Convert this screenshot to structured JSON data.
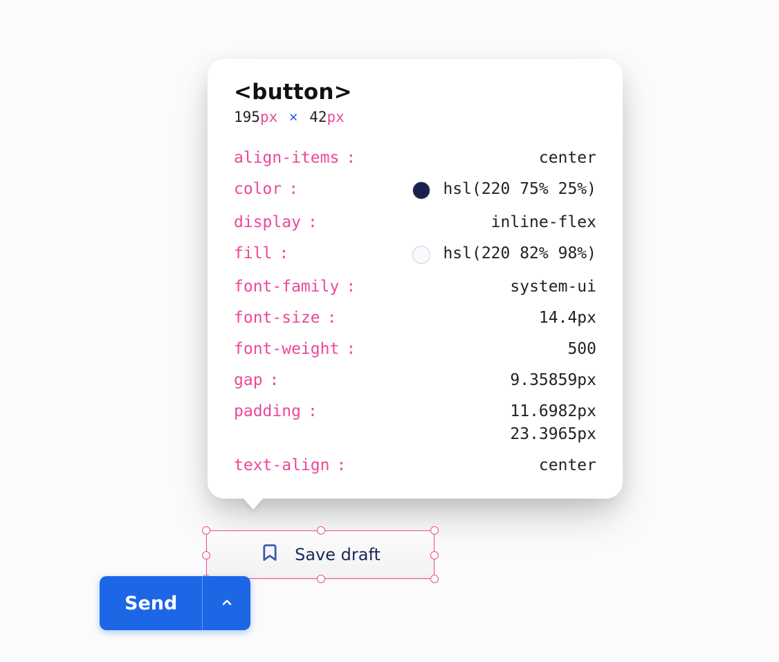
{
  "inspector": {
    "element_tag": "<button>",
    "dimensions": {
      "w": "195",
      "h": "42",
      "unit": "px"
    },
    "properties": [
      {
        "name": "align-items",
        "value": "center"
      },
      {
        "name": "color",
        "value": "hsl(220 75% 25%)",
        "swatch": "#17234d"
      },
      {
        "name": "display",
        "value": "inline-flex"
      },
      {
        "name": "fill",
        "value": "hsl(220 82% 98%)",
        "swatch": "#f7faff"
      },
      {
        "name": "font-family",
        "value": "system-ui"
      },
      {
        "name": "font-size",
        "value": "14.4px"
      },
      {
        "name": "font-weight",
        "value": "500"
      },
      {
        "name": "gap",
        "value": "9.35859px"
      },
      {
        "name": "padding",
        "value": "11.6982px",
        "value2": "23.3965px"
      },
      {
        "name": "text-align",
        "value": "center"
      }
    ]
  },
  "selected_button": {
    "label": "Save draft",
    "icon": "bookmark-icon"
  },
  "send_button": {
    "label": "Send",
    "caret_icon": "chevron-up-icon"
  }
}
